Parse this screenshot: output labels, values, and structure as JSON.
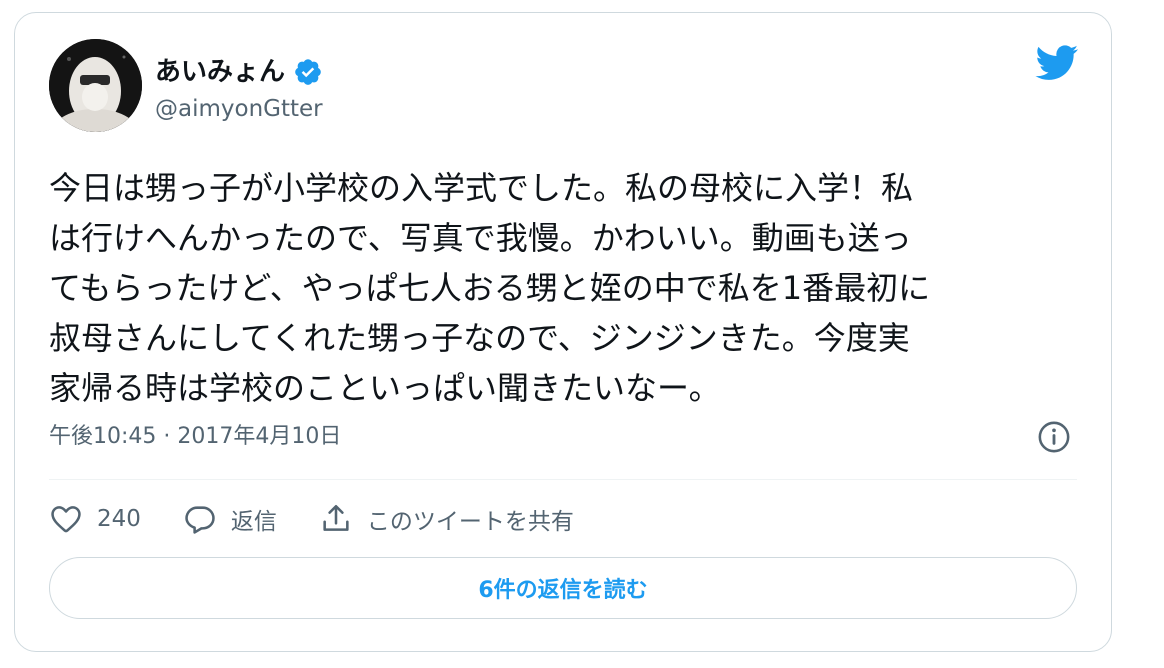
{
  "user": {
    "display_name": "あいみょん",
    "handle": "@aimyonGtter",
    "verified": true
  },
  "tweet": {
    "lines": [
      "今日は甥っ子が小学校の入学式でした。私の母校に入学！私",
      "は行けへんかったので、写真で我慢。かわいい。動画も送っ",
      "てもらったけど、やっぱ七人おる甥と姪の中で私を1番最初に",
      "叔母さんにしてくれた甥っ子なので、ジンジンきた。今度実",
      "家帰る時は学校のこといっぱい聞きたいなー。"
    ],
    "timestamp": "午後10:45 · 2017年4月10日"
  },
  "actions": {
    "like_count": "240",
    "reply_label": "返信",
    "share_label": "このツイートを共有"
  },
  "replies_button": {
    "label": "6件の返信を読む"
  },
  "icons": {
    "brand": "twitter-bird-icon",
    "verified": "verified-badge-icon",
    "info": "info-icon",
    "like": "heart-icon",
    "reply": "speech-bubble-icon",
    "share": "share-upload-icon"
  },
  "colors": {
    "accent": "#1d9bf0",
    "text": "#0f1419",
    "secondary_text": "#536471",
    "border": "#cfd9de"
  }
}
